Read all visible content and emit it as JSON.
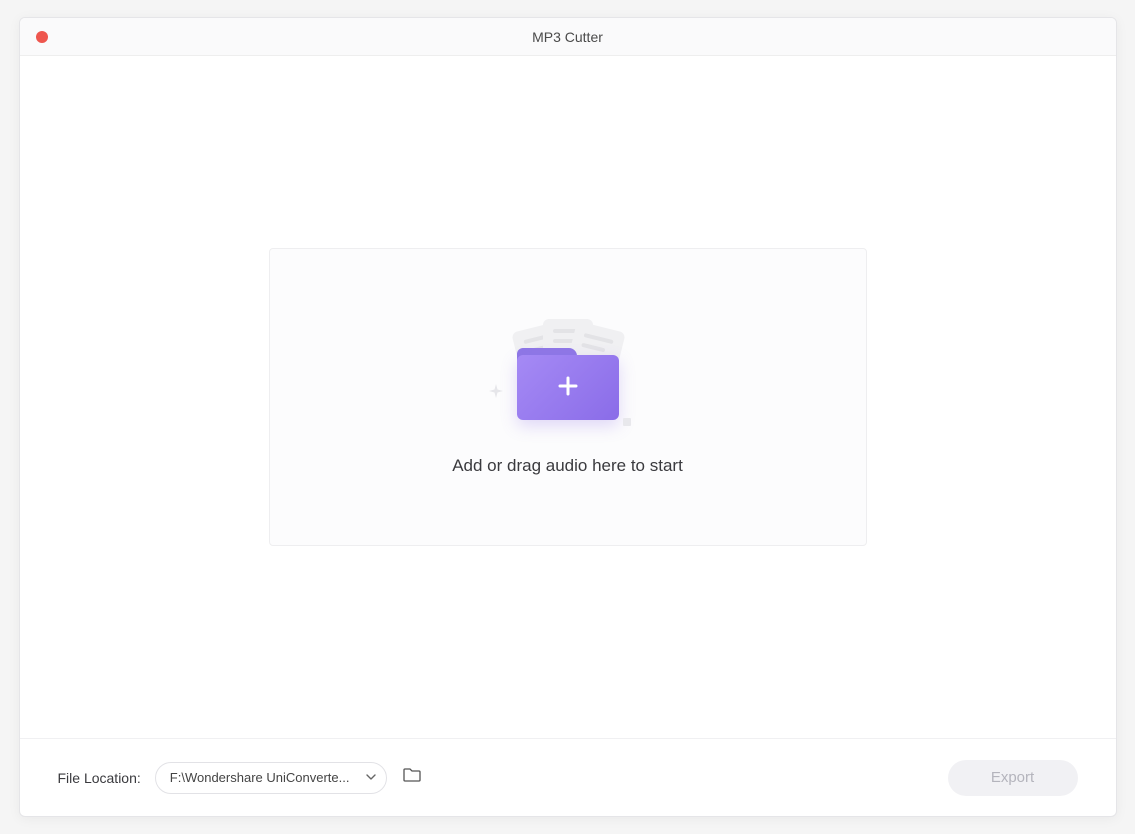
{
  "window": {
    "title": "MP3 Cutter"
  },
  "dropzone": {
    "prompt": "Add or drag audio here to start"
  },
  "footer": {
    "file_location_label": "File Location:",
    "file_location_path": "F:\\Wondershare UniConverte...",
    "export_label": "Export"
  }
}
